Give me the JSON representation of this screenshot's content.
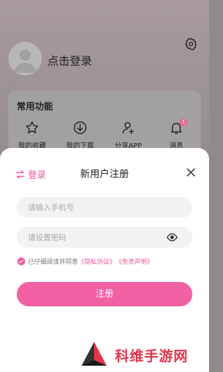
{
  "profile": {
    "login_prompt": "点击登录"
  },
  "functions": {
    "title": "常用功能",
    "items": [
      {
        "label": "我的收藏",
        "icon": "star-icon"
      },
      {
        "label": "我的下载",
        "icon": "download-icon"
      },
      {
        "label": "分享APP",
        "icon": "share-user-icon"
      },
      {
        "label": "消息",
        "icon": "bell-icon",
        "badge": "1"
      }
    ]
  },
  "sheet": {
    "switch_label": "登录",
    "title": "新用户注册",
    "phone_placeholder": "请输入手机号",
    "password_placeholder": "请设置密码",
    "agree_text": "已仔细阅读并同意",
    "privacy_link": "《隐私协议》",
    "disclaimer_link": "《免责声明》",
    "register_label": "注册"
  },
  "watermark": {
    "text": "科维手游网"
  },
  "colors": {
    "accent": "#f0549b",
    "button": "#f260a4"
  }
}
